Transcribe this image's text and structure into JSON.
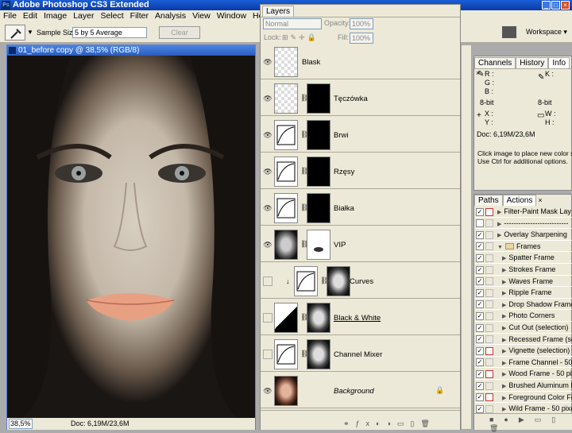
{
  "app": {
    "title": "Adobe Photoshop CS3 Extended"
  },
  "menu": [
    "File",
    "Edit",
    "Image",
    "Layer",
    "Select",
    "Filter",
    "Analysis",
    "View",
    "Window",
    "Help"
  ],
  "options": {
    "sample_label": "Sample Size:",
    "sample_value": "5 by 5 Average",
    "clear_label": "Clear",
    "workspace_label": "Workspace"
  },
  "document": {
    "title": "01_before copy @ 38,5% (RGB/8)",
    "zoom": "38,5%",
    "doc_info": "Doc: 6,19M/23,6M"
  },
  "layers_panel": {
    "tab": "Layers",
    "blend_mode": "Normal",
    "opacity_label": "Opacity:",
    "opacity": "100%",
    "lock_label": "Lock:",
    "fill_label": "Fill:",
    "fill": "100%",
    "layers": [
      {
        "name": "Blask",
        "italic": false
      },
      {
        "name": "Tęczówka",
        "italic": false
      },
      {
        "name": "Brwi",
        "italic": false
      },
      {
        "name": "Rzęsy",
        "italic": false
      },
      {
        "name": "Białka",
        "italic": false
      },
      {
        "name": "VIP",
        "italic": false
      },
      {
        "name": "Curves",
        "italic": false
      },
      {
        "name": "Black & White",
        "italic": false
      },
      {
        "name": "Channel Mixer",
        "italic": false
      },
      {
        "name": "Background",
        "italic": true
      }
    ]
  },
  "info_panel": {
    "tabs": [
      "Channels",
      "History",
      "Info"
    ],
    "rgb": [
      "R :",
      "G :",
      "B :"
    ],
    "cmyk": [
      "K :"
    ],
    "bit1": "8-bit",
    "bit2": "8-bit",
    "xy": [
      "X :",
      "Y :"
    ],
    "wh": [
      "W :",
      "H :"
    ],
    "doc": "Doc: 6,19M/23,6M",
    "hint1": "Click image to place new color samp",
    "hint2": "Use Ctrl for additional options."
  },
  "actions_panel": {
    "tabs": [
      "Paths",
      "Actions"
    ],
    "items": [
      {
        "label": "Filter-Paint Mask Lay",
        "dialog": true
      },
      {
        "label": "---------------------------",
        "dialog": false
      },
      {
        "label": "Overlay Sharpening",
        "dialog": false
      },
      {
        "label": "Frames",
        "dialog": false
      },
      {
        "label": "Spatter Frame",
        "dialog": false
      },
      {
        "label": "Strokes Frame",
        "dialog": false
      },
      {
        "label": "Waves Frame",
        "dialog": false
      },
      {
        "label": "Ripple Frame",
        "dialog": false
      },
      {
        "label": "Drop Shadow Frame",
        "dialog": false
      },
      {
        "label": "Photo Corners",
        "dialog": false
      },
      {
        "label": "Cut Out (selection)",
        "dialog": false
      },
      {
        "label": "Recessed Frame (selection)",
        "dialog": false
      },
      {
        "label": "Vignette (selection)",
        "dialog": true
      },
      {
        "label": "Frame Channel - 50 p",
        "dialog": false
      },
      {
        "label": "Wood Frame - 50 pix",
        "dialog": true
      },
      {
        "label": "Brushed Aluminum Fr",
        "dialog": false
      },
      {
        "label": "Foreground Color Fr",
        "dialog": true
      },
      {
        "label": "Wild Frame - 50 pixe",
        "dialog": false
      }
    ]
  }
}
